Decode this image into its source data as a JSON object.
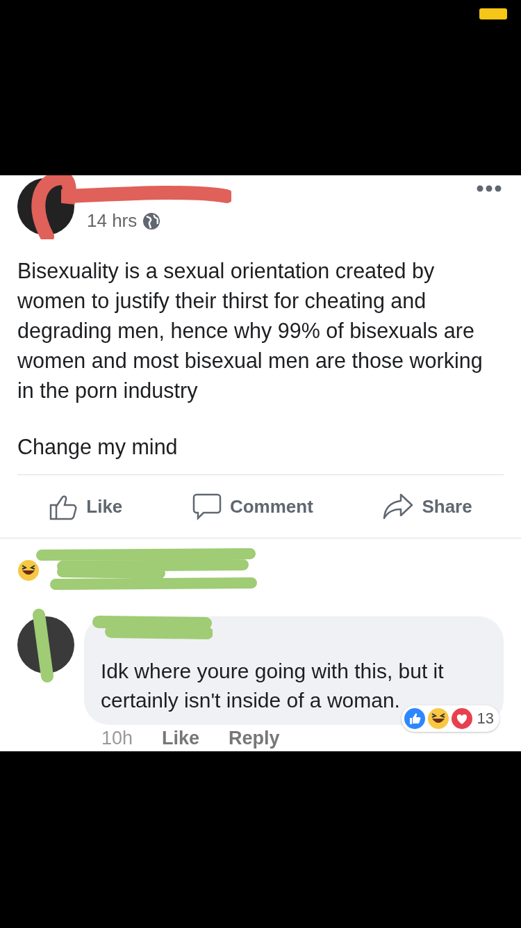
{
  "post": {
    "time": "14 hrs",
    "body": "Bisexuality is a sexual orientation created by women to justify their thirst for cheating and degrading men, hence why 99% of bisexuals are women and most bisexual men are those working in the porn industry",
    "closing": "Change my mind",
    "actions": [
      {
        "kind": "like",
        "label": "Like"
      },
      {
        "kind": "comment",
        "label": "Comment"
      },
      {
        "kind": "share",
        "label": "Share"
      }
    ]
  },
  "comment": {
    "text": "Idk where youre going with this, but it certainly isn't inside of a woman.",
    "time": "10h",
    "like": "Like",
    "reply": "Reply",
    "reaction_count": "13"
  }
}
